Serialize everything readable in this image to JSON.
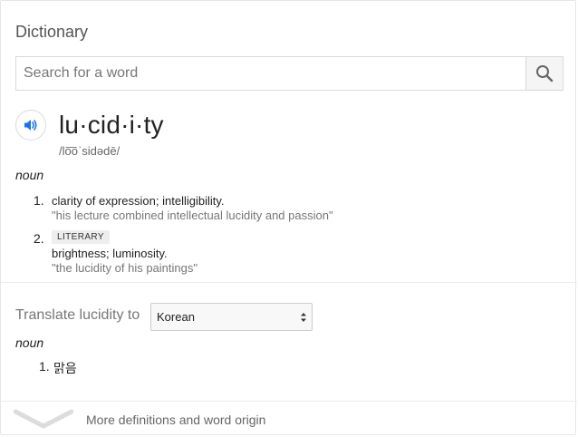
{
  "widget": {
    "title": "Dictionary"
  },
  "search": {
    "placeholder": "Search for a word"
  },
  "entry": {
    "headword": "lu·cid·i·ty",
    "phonetic": "/lo͞oˈsidədē/",
    "part_of_speech": "noun",
    "definitions": [
      {
        "number": "1.",
        "text": "clarity of expression; intelligibility.",
        "example": "\"his lecture combined intellectual lucidity and passion\""
      },
      {
        "number": "2.",
        "register": "LITERARY",
        "text": "brightness; luminosity.",
        "example": "\"the lucidity of his paintings\""
      }
    ]
  },
  "translate": {
    "label": "Translate lucidity to",
    "selected_language": "Korean",
    "part_of_speech": "noun",
    "results": [
      {
        "number": "1.",
        "word": "맑음"
      }
    ]
  },
  "more_link": {
    "label": "More definitions and word origin"
  },
  "colors": {
    "accent": "#4285f4",
    "muted": "#777777",
    "divider": "#ebebeb"
  },
  "icons": {
    "search": "search-icon",
    "audio": "speaker-icon",
    "expand": "chevron-down-icon",
    "select": "select-arrows-icon"
  }
}
